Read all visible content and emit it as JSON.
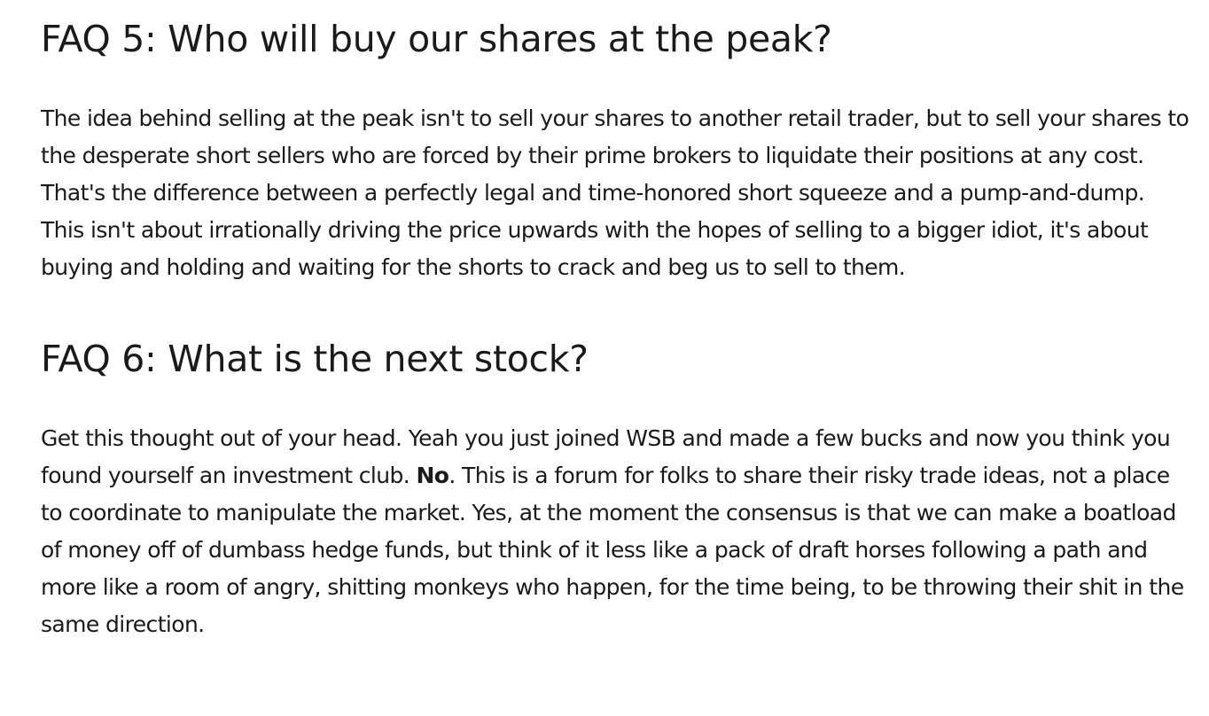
{
  "faq5": {
    "heading": "FAQ 5: Who will buy our shares at the peak?",
    "body": "The idea behind selling at the peak isn't to sell your shares to another retail trader, but to sell your shares to the desperate short sellers who are forced by their prime brokers to liquidate their positions at any cost. That's the difference between a perfectly legal and time-honored short squeeze and a pump-and-dump. This isn't about irrationally driving the price upwards with the hopes of selling to a bigger idiot, it's about buying and holding and waiting for the shorts to crack and beg us to sell to them."
  },
  "faq6": {
    "heading": "FAQ 6: What is the next stock?",
    "body_part1": "Get this thought out of your head. Yeah you just joined WSB and made a few bucks and now you think you found yourself an investment club. ",
    "body_bold": "No",
    "body_part2": ". This is a forum for folks to share their risky trade ideas, not a place to coordinate to manipulate the market. Yes, at the moment the consensus is that we can make a boatload of money off of dumbass hedge funds, but think of it less like a pack of draft horses following a path and more like a room of angry, shitting monkeys who happen, for the time being, to be throwing their shit in the same direction."
  }
}
